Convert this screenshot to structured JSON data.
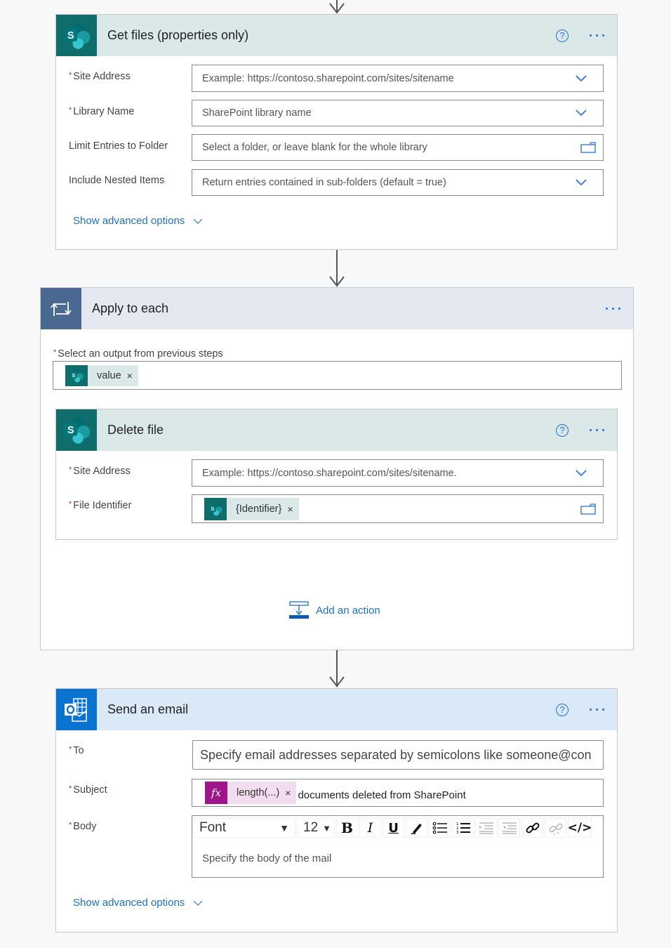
{
  "colors": {
    "accent": "#1f6fe0",
    "link": "#1f6fc6",
    "sharepoint": "#0f6e6b",
    "loop": "#4a6890",
    "outlook": "#0a72cf",
    "expression": "#a0148c",
    "required": "#c4262e"
  },
  "get_files": {
    "title": "Get files (properties only)",
    "icon": "sharepoint-icon",
    "fields": [
      {
        "label": "Site Address",
        "required": true,
        "placeholder": "Example: https://contoso.sharepoint.com/sites/sitename",
        "control": "dropdown"
      },
      {
        "label": "Library Name",
        "required": true,
        "placeholder": "SharePoint library name",
        "control": "dropdown"
      },
      {
        "label": "Limit Entries to Folder",
        "required": false,
        "placeholder": "Select a folder, or leave blank for the whole library",
        "control": "folder-picker"
      },
      {
        "label": "Include Nested Items",
        "required": false,
        "placeholder": "Return entries contained in sub-folders (default = true)",
        "control": "dropdown"
      }
    ],
    "advanced_label": "Show advanced options"
  },
  "apply_each": {
    "title": "Apply to each",
    "icon": "loop-icon",
    "output_label": "Select an output from previous steps",
    "output_token": "value",
    "add_action_label": "Add an action",
    "delete_file": {
      "title": "Delete file",
      "icon": "sharepoint-icon",
      "fields": [
        {
          "label": "Site Address",
          "required": true,
          "placeholder": "Example: https://contoso.sharepoint.com/sites/sitename.",
          "control": "dropdown"
        },
        {
          "label": "File Identifier",
          "required": true,
          "token": "{Identifier}",
          "control": "folder-picker"
        }
      ]
    }
  },
  "send_email": {
    "title": "Send an email",
    "icon": "outlook-icon",
    "to": {
      "label": "To",
      "required": true,
      "placeholder": "Specify email addresses separated by semicolons like someone@con"
    },
    "subject": {
      "label": "Subject",
      "required": true,
      "token": "length(...)",
      "text": "documents deleted from SharePoint"
    },
    "body": {
      "label": "Body",
      "required": true,
      "font": "Font",
      "size": "12",
      "placeholder": "Specify the body of the mail",
      "toolbar": [
        "bold",
        "italic",
        "underline",
        "highlight",
        "bulleted-list",
        "numbered-list",
        "increase-indent",
        "decrease-indent",
        "link",
        "unlink",
        "code-view"
      ]
    },
    "advanced_label": "Show advanced options"
  },
  "glyphs": {
    "required_mark": "*",
    "remove": "×",
    "help": "?",
    "bold": "B",
    "italic": "I",
    "underline": "U",
    "code": "</>",
    "caret": "▼",
    "fx": "fx"
  }
}
